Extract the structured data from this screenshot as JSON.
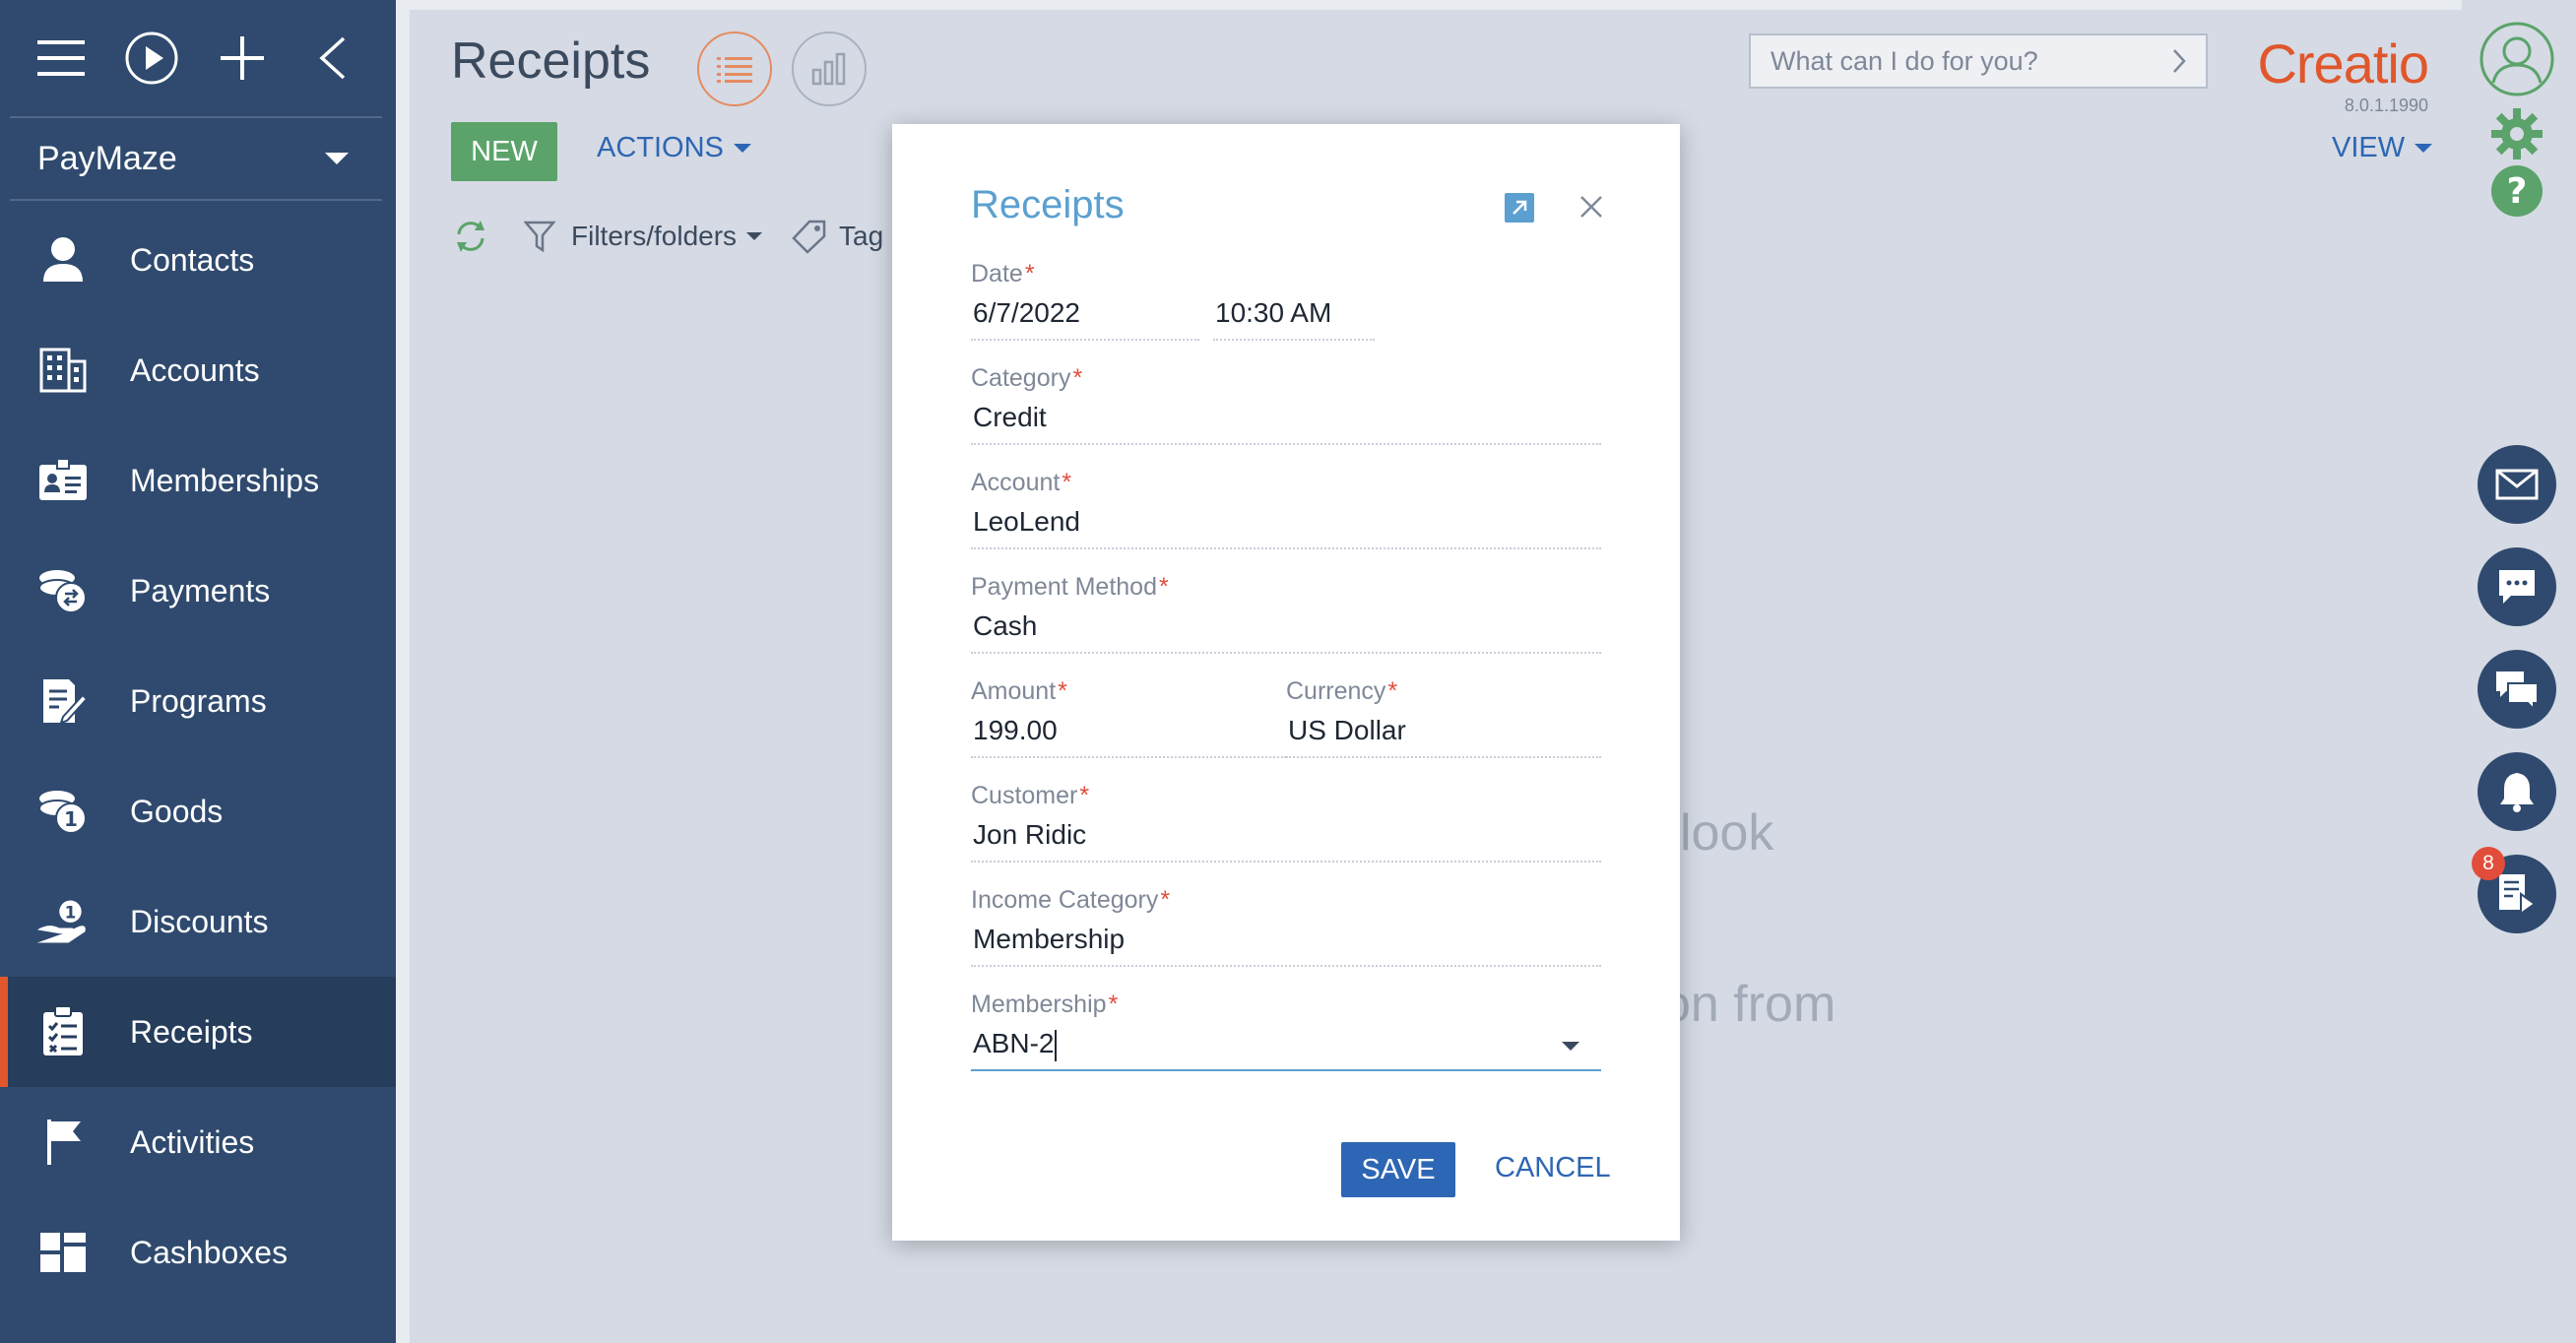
{
  "sidebar": {
    "workspace": "PayMaze",
    "items": [
      {
        "label": "Contacts",
        "icon": "person-icon"
      },
      {
        "label": "Accounts",
        "icon": "building-icon"
      },
      {
        "label": "Memberships",
        "icon": "id-card-icon"
      },
      {
        "label": "Payments",
        "icon": "coins-exchange-icon"
      },
      {
        "label": "Programs",
        "icon": "document-edit-icon"
      },
      {
        "label": "Goods",
        "icon": "coins-one-icon"
      },
      {
        "label": "Discounts",
        "icon": "hand-coin-icon"
      },
      {
        "label": "Receipts",
        "icon": "clipboard-list-icon",
        "active": true
      },
      {
        "label": "Activities",
        "icon": "flag-icon"
      },
      {
        "label": "Cashboxes",
        "icon": "blocks-icon"
      }
    ]
  },
  "header": {
    "title": "Receipts",
    "new_label": "NEW",
    "actions_label": "ACTIONS",
    "filters_label": "Filters/folders",
    "tag_label": "Tag",
    "search_placeholder": "What can I do for you?",
    "brand": "Creatio",
    "version": "8.0.1.1990",
    "view_label": "VIEW"
  },
  "background": {
    "text_1": "look",
    "text_2": "on from"
  },
  "rail": {
    "badge_count": "8"
  },
  "modal": {
    "title": "Receipts",
    "date_label": "Date",
    "date_value": "6/7/2022",
    "time_value": "10:30 AM",
    "category_label": "Category",
    "category_value": "Credit",
    "account_label": "Account",
    "account_value": "LeoLend",
    "payment_method_label": "Payment Method",
    "payment_method_value": "Cash",
    "amount_label": "Amount",
    "amount_value": "199.00",
    "currency_label": "Currency",
    "currency_value": "US Dollar",
    "customer_label": "Customer",
    "customer_value": "Jon Ridic",
    "income_category_label": "Income Category",
    "income_category_value": "Membership",
    "membership_label": "Membership",
    "membership_value": "ABN-2",
    "save_label": "SAVE",
    "cancel_label": "CANCEL"
  },
  "colors": {
    "sidebar": "#2f4a6e",
    "accent_orange": "#e0572c",
    "primary_blue": "#2d66b4",
    "green": "#5ba36a"
  }
}
